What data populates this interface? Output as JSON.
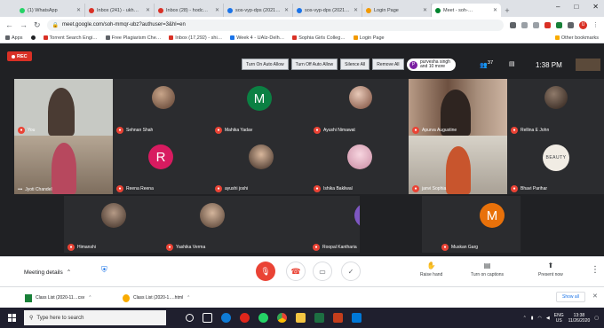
{
  "browser": {
    "tabs": [
      {
        "label": "(1) WhatsApp",
        "color": "#25d366"
      },
      {
        "label": "Inbox (241) - ukh…",
        "color": "#d93025"
      },
      {
        "label": "Inbox (28) - hodc…",
        "color": "#d93025"
      },
      {
        "label": "sos-vyp-dps (2021…",
        "color": "#1a73e8"
      },
      {
        "label": "sos-vyp-dps (2021…",
        "color": "#1a73e8"
      },
      {
        "label": "Login Page",
        "color": "#f29900"
      },
      {
        "label": "Meet - soh-…",
        "color": "#00832d"
      }
    ],
    "new_tab": "+",
    "window_controls": {
      "minimize": "–",
      "maximize": "□",
      "close": "✕"
    },
    "url": "meet.google.com/soh-mmqr-ubz?authuser=3&hl=en",
    "profile_initial": "U",
    "bookmarks": [
      {
        "label": "Apps",
        "color": "#5f6368"
      },
      {
        "label": "",
        "color": "#202124"
      },
      {
        "label": "Torrent Search Engi…",
        "color": "#d93025"
      },
      {
        "label": "Free Plagiarism Che…",
        "color": "#5f6368"
      },
      {
        "label": "Inbox (17,292) - shi…",
        "color": "#d93025"
      },
      {
        "label": "Week 4 - UAIz-Delh…",
        "color": "#1a73e8"
      },
      {
        "label": "Sophia Girls Colleg…",
        "color": "#d93025"
      },
      {
        "label": "Login Page",
        "color": "#f29900"
      }
    ],
    "other_bookmarks": "Other bookmarks"
  },
  "meet": {
    "rec_label": "REC",
    "ext_buttons": [
      "Turn On Auto Allow",
      "Turn Off Auto Allow",
      "Silence All",
      "Remove All"
    ],
    "presenter": {
      "initial": "P",
      "line1": "purvesha singh",
      "line2": "and 10 more"
    },
    "people_count": "37",
    "time": "1:38 PM",
    "participants": [
      {
        "name": "You"
      },
      {
        "name": "Sehnan Shah"
      },
      {
        "name": "Mahika Yadav",
        "initial": "M",
        "color": "#0b8043"
      },
      {
        "name": "Ayushi Nimawat"
      },
      {
        "name": "Apurva Augustine"
      },
      {
        "name": "Rellina E John"
      },
      {
        "name": "Jyoti Chandel"
      },
      {
        "name": "Reena Reena",
        "initial": "R",
        "color": "#d81b60"
      },
      {
        "name": "ayushi joshi"
      },
      {
        "name": "Ishika Bakliwal"
      },
      {
        "name": "janvi Sophia"
      },
      {
        "name": "Bhavi Parihar",
        "badge": "BEAUTY"
      },
      {
        "name": "Himanshi"
      },
      {
        "name": "Yashika Verma"
      },
      {
        "name": "Roopal Kantharia",
        "initial": "R",
        "color": "#7e57c2"
      },
      {
        "name": "Muskan Garg",
        "initial": "M",
        "color": "#e8710a"
      }
    ],
    "controls": {
      "meeting_details": "Meeting details",
      "raise_hand": "Raise hand",
      "captions": "Turn on captions",
      "present": "Present now"
    }
  },
  "downloads": {
    "items": [
      {
        "label": "Class List (2020-11…csv"
      },
      {
        "label": "Class List (2020-1….html"
      }
    ],
    "show_all": "Show all"
  },
  "taskbar": {
    "search_placeholder": "Type here to search",
    "lang": "ENG",
    "region": "US",
    "time": "13:38",
    "date": "11/26/2020"
  }
}
